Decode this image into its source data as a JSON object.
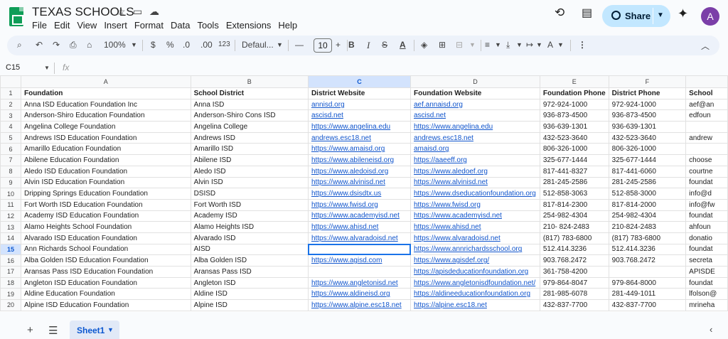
{
  "doc": {
    "title": "TEXAS SCHOOLS"
  },
  "menu": [
    "File",
    "Edit",
    "View",
    "Insert",
    "Format",
    "Data",
    "Tools",
    "Extensions",
    "Help"
  ],
  "share": {
    "label": "Share"
  },
  "avatar": {
    "initial": "A"
  },
  "toolbar": {
    "zoom": "100%",
    "currency": "$",
    "percent": "%",
    "dec_decrease": ".0",
    "dec_increase": ".00",
    "number_format": "123",
    "font": "Defaul...",
    "font_size": "10",
    "bold": "B",
    "italic": "I"
  },
  "formula_bar": {
    "cell_ref": "C15",
    "fx": "fx",
    "value": ""
  },
  "columns": [
    "A",
    "B",
    "C",
    "D",
    "E",
    "F"
  ],
  "rows": [
    {
      "num": "1",
      "cells": [
        "Foundation",
        "School District",
        "District Website",
        "Foundation Website",
        "Foundation Phone",
        "District Phone",
        "School"
      ]
    },
    {
      "num": "2",
      "cells": [
        "Anna ISD Education Foundation Inc",
        "Anna ISD",
        "annisd.org",
        "aef.annaisd.org",
        "972-924-1000",
        "972-924-1000",
        "aef@an"
      ]
    },
    {
      "num": "3",
      "cells": [
        "Anderson-Shiro Education Foundation",
        "Anderson-Shiro Cons ISD",
        "ascisd.net",
        "ascisd.net",
        "936-873-4500",
        "936-873-4500",
        "edfoun"
      ]
    },
    {
      "num": "4",
      "cells": [
        "Angelina College Foundation",
        "Angelina College",
        "https://www.angelina.edu",
        "https://www.angelina.edu",
        "936-639-1301",
        "936-639-1301",
        ""
      ]
    },
    {
      "num": "5",
      "cells": [
        "Andrews ISD Education Foundation",
        "Andrews ISD",
        "andrews.esc18.net",
        "andrews.esc18.net",
        "432-523-3640",
        "432-523-3640",
        "andrew"
      ]
    },
    {
      "num": "6",
      "cells": [
        "Amarillo Education Foundation",
        "Amarillo ISD",
        "https://www.amaisd.org",
        "amaisd.org",
        "806-326-1000",
        "806-326-1000",
        ""
      ]
    },
    {
      "num": "7",
      "cells": [
        "Abilene Education Foundation",
        "Abilene ISD",
        "https://www.abileneisd.org",
        "https://aaeeff.org",
        "325-677-1444",
        "325-677-1444",
        "choose"
      ]
    },
    {
      "num": "8",
      "cells": [
        "Aledo ISD Education Foundation",
        "Aledo ISD",
        "https://www.aledoisd.org",
        "https://www.aledoef.org",
        "817-441-8327",
        "817-441-6060",
        "courtne"
      ]
    },
    {
      "num": "9",
      "cells": [
        "Alvin ISD Education Foundation",
        "Alvin ISD",
        "https://www.alvinisd.net",
        "https://www.alvinisd.net",
        "281-245-2586",
        "281-245-2586",
        "foundat"
      ]
    },
    {
      "num": "10",
      "cells": [
        "Dripping Springs Education Foundation",
        "DSISD",
        "https://www.dsisdtx.us",
        "https://www.dseducationfoundation.org",
        "512-858-3063",
        "512-858-3000",
        "info@d"
      ]
    },
    {
      "num": "11",
      "cells": [
        "Fort Worth ISD Education Foundation",
        "Fort Worth ISD",
        "https://www.fwisd.org",
        "https://www.fwisd.org",
        "  817-814-2300",
        "817-814-2000",
        "info@fw"
      ]
    },
    {
      "num": "12",
      "cells": [
        "Academy ISD Education Foundation",
        "Academy ISD",
        "https://www.academyisd.net",
        "https://www.academyisd.net",
        "254-982-4304",
        "254-982-4304",
        "foundat"
      ]
    },
    {
      "num": "13",
      "cells": [
        "Alamo Heights School Foundation",
        "Alamo Heights ISD",
        "https://www.ahisd.net",
        "https://www.ahisd.net",
        "210- 824-2483",
        "210-824-2483",
        "ahfoun"
      ]
    },
    {
      "num": "14",
      "cells": [
        "Alvarado ISD Education Foundation",
        "Alvarado ISD",
        "https://www.alvaradoisd.net",
        "https://www.alvaradoisd.net",
        "(817) 783-6800",
        "(817) 783-6800",
        "donatio"
      ]
    },
    {
      "num": "15",
      "cells": [
        "Ann Richards School Foundation",
        "AISD",
        "",
        "https://www.annrichardsschool.org",
        "512.414.3236",
        "512.414.3236",
        "foundat"
      ]
    },
    {
      "num": "16",
      "cells": [
        "Alba Golden ISD Education Foundation",
        "Alba Golden ISD",
        "https://www.agisd.com",
        "https://www.agisdef.org/",
        "903.768.2472",
        "903.768.2472",
        "secreta"
      ]
    },
    {
      "num": "17",
      "cells": [
        "Aransas Pass ISD Education Foundation",
        "Aransas Pass ISD",
        "",
        "https://apisdeducationfoundation.org",
        "361-758-4200",
        "",
        "APISDE"
      ]
    },
    {
      "num": "18",
      "cells": [
        "Angleton ISD Education Foundation",
        "Angleton ISD",
        "https://www.angletonisd.net",
        "https://www.angletonisdfoundation.net/",
        "979-864-8047",
        "979-864-8000",
        "foundat"
      ]
    },
    {
      "num": "19",
      "cells": [
        "Aldine Education Foundation",
        "Aldine ISD",
        "https://www.aldineisd.org",
        "https://aldineeducationfoundation.org",
        "281-985-6078",
        "281-449-1011",
        "lfolson@"
      ]
    },
    {
      "num": "20",
      "cells": [
        "Alpine ISD Education Foundation",
        "Alpine ISD",
        "https://www.alpine.esc18.net",
        "https://alpine.esc18.net",
        "432-837-7700",
        "432-837-7700",
        "mrineha"
      ]
    }
  ],
  "sheet": {
    "tab": "Sheet1"
  }
}
